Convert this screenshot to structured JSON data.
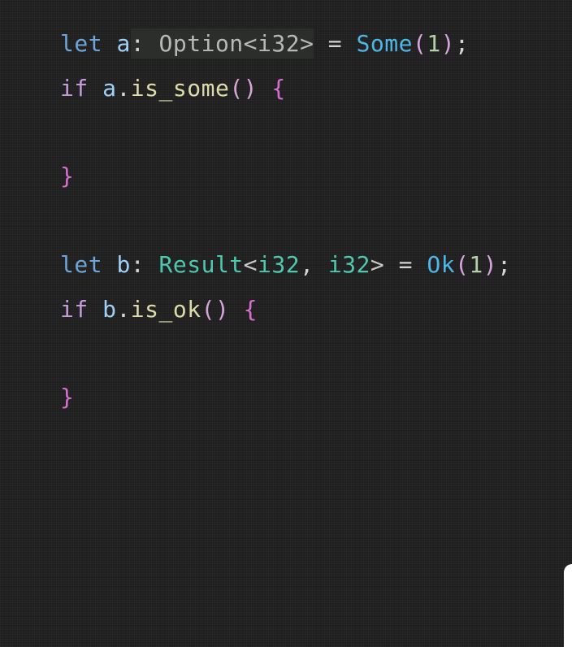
{
  "editor": {
    "lines": [
      {
        "kw": "let",
        "var": "a",
        "colon": ":",
        "type_hint": " Option<i32>",
        "eq": " = ",
        "ctor": "Some",
        "open": "(",
        "num": "1",
        "close": ")",
        "semi": ";"
      },
      {
        "kw": "if",
        "var": "a",
        "dot": ".",
        "method": "is_some",
        "parens": "()",
        "brace": "{"
      },
      {
        "brace": "}"
      },
      {
        "kw": "let",
        "var": "b",
        "colon": ":",
        "type_name": "Result",
        "lt": "<",
        "t1": "i32",
        "comma": ", ",
        "t2": "i32",
        "gt": ">",
        "eq": " = ",
        "ctor": "Ok",
        "open": "(",
        "num": "1",
        "close": ")",
        "semi": ";"
      },
      {
        "kw": "if",
        "var": "b",
        "dot": ".",
        "method": "is_ok",
        "parens": "()",
        "brace": "{"
      },
      {
        "brace": "}"
      }
    ]
  },
  "colors": {
    "background": "#1f1f1f",
    "keyword_let": "#6fa6d9",
    "keyword_if": "#c59ad9",
    "variable": "#9fd0f5",
    "type": "#4ec9b0",
    "constructor": "#4fb6e8",
    "number": "#b5cea8",
    "method": "#dcdcaa",
    "brace": "#d86fd0"
  }
}
